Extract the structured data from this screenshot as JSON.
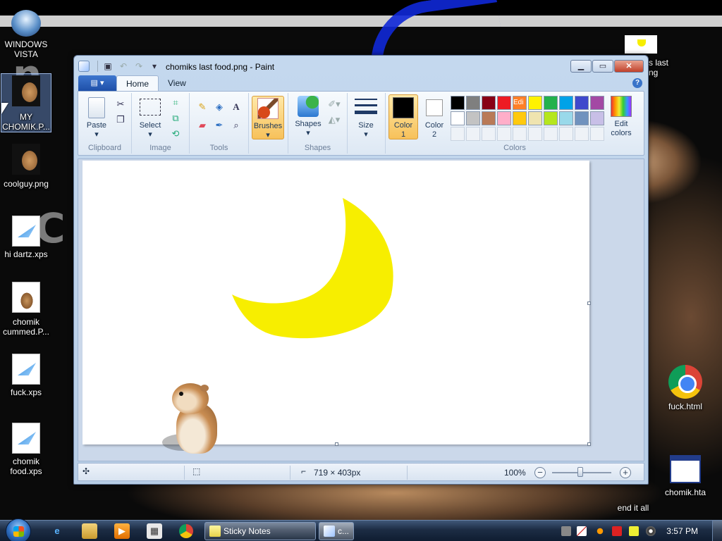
{
  "desktop": {
    "wallpaper_text": [
      "n",
      "C"
    ],
    "icons": [
      {
        "label": "WINDOWS\nVISTA",
        "kind": "vista-ic"
      },
      {
        "label": "MY\nCHOMIK.P...",
        "kind": "thumb-ic"
      },
      {
        "label": "coolguy.png",
        "kind": "thumb-ic"
      },
      {
        "label": "hi dartz.xps",
        "kind": "xps-ic"
      },
      {
        "label": "chomik\ncummed.P...",
        "kind": "ham-ic"
      },
      {
        "label": "fuck.xps",
        "kind": "xps-ic"
      },
      {
        "label": "chomik\nfood.xps",
        "kind": "xps-ic"
      },
      {
        "label": "fuck.html",
        "kind": "chrome-ic"
      },
      {
        "label": "chomik.hta",
        "kind": "hta-ic"
      },
      {
        "label": "end it all",
        "kind": "thumb-ic"
      },
      {
        "label": "s last\nng",
        "kind": "thumb-ic"
      }
    ]
  },
  "window": {
    "title": "chomiks last food.png - Paint",
    "buttons": {
      "minimize": "▁",
      "maximize": "▭",
      "close": "✕"
    },
    "file_tab_icon": "▤ ▾",
    "tabs": [
      "Home",
      "View"
    ],
    "help": "?",
    "ribbon": {
      "clipboard": {
        "label": "Clipboard",
        "paste": "Paste"
      },
      "image": {
        "label": "Image",
        "select": "Select"
      },
      "tools": {
        "label": "Tools"
      },
      "brushes": {
        "label": "Brushes"
      },
      "shapes": {
        "label": "Shapes",
        "button": "Shapes"
      },
      "size": {
        "label": "Size"
      },
      "colors": {
        "label": "Colors",
        "color1": "Color\n1",
        "color2": "Color\n2",
        "edit": "Edit\ncolors",
        "color1_value": "#000000",
        "color2_value": "#ffffff",
        "palette_row1": [
          "#000000",
          "#7f7f7f",
          "#880015",
          "#ed1c24",
          "#ff7f27",
          "#fff200",
          "#22b14c",
          "#00a2e8",
          "#3f48cc",
          "#a349a4"
        ],
        "palette_row2": [
          "#ffffff",
          "#c3c3c3",
          "#b97a57",
          "#ffaec9",
          "#ffc90e",
          "#efe4b0",
          "#b5e61d",
          "#99d9ea",
          "#7092be",
          "#c8bfe7"
        ],
        "orange_swatch_text": "Edi"
      }
    },
    "canvas": {
      "moon_color": "#f7ee00"
    },
    "status": {
      "size": "719 × 403px",
      "zoom": "100%",
      "zoom_out": "−",
      "zoom_in": "+"
    }
  },
  "taskbar": {
    "tasks": [
      {
        "label": "Sticky Notes"
      },
      {
        "label": "c..."
      }
    ],
    "clock": "3:57 PM"
  }
}
